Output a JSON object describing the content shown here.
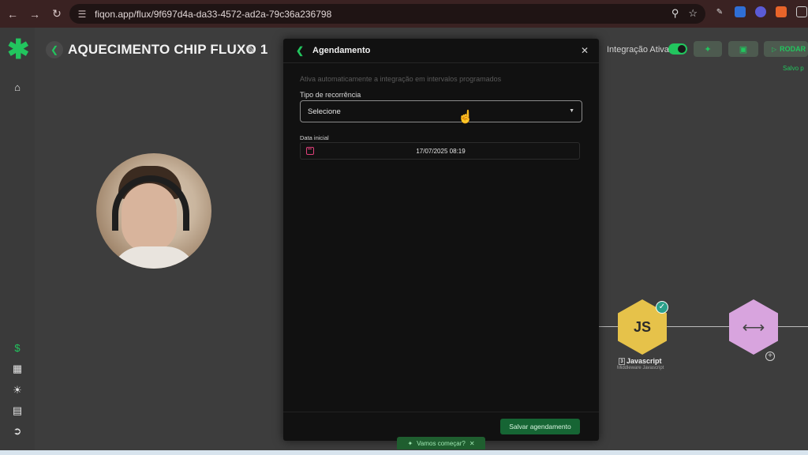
{
  "browser": {
    "url": "fiqon.app/flux/9f697d4a-da33-4572-ad2a-79c36a236798"
  },
  "header": {
    "title": "AQUECIMENTO CHIP FLUXO 1",
    "integration_label": "Integração Ativa",
    "integration_active": true,
    "run_label": "RODAR",
    "saved_text": "Salvo p"
  },
  "modal": {
    "title": "Agendamento",
    "description": "Ativa automaticamente a integração em intervalos programados",
    "recurrence_label": "Tipo de recorrência",
    "recurrence_value": "Selecione",
    "start_date_label": "Data inicial",
    "start_date_value": "17/07/2025 08:19",
    "save_label": "Salvar agendamento"
  },
  "nodes": {
    "js": {
      "icon_text": "JS",
      "number": "3",
      "label": "Javascript",
      "sublabel": "Middleware Javascript"
    }
  },
  "toast": {
    "text": "Vamos começar?"
  },
  "colors": {
    "accent": "#22c55e",
    "js_node": "#e6c24a",
    "router_node": "#d8a4de"
  }
}
